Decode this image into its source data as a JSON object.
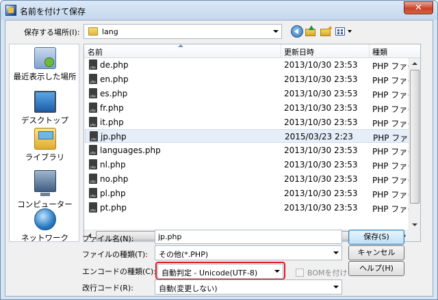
{
  "window": {
    "title": "名前を付けて保存",
    "close_label": "✕"
  },
  "save_location": {
    "label": "保存する場所(I):",
    "value": "lang"
  },
  "places": [
    {
      "label": "最近表示した場所"
    },
    {
      "label": "デスクトップ"
    },
    {
      "label": "ライブラリ"
    },
    {
      "label": "コンピューター"
    },
    {
      "label": "ネットワーク"
    }
  ],
  "columns": {
    "name": "名前",
    "date": "更新日時",
    "type": "種類"
  },
  "files": [
    {
      "name": "de.php",
      "date": "2013/10/30 23:53",
      "type": "PHP ファイ"
    },
    {
      "name": "en.php",
      "date": "2013/10/30 23:53",
      "type": "PHP ファイ"
    },
    {
      "name": "es.php",
      "date": "2013/10/30 23:53",
      "type": "PHP ファイ"
    },
    {
      "name": "fr.php",
      "date": "2013/10/30 23:53",
      "type": "PHP ファイ"
    },
    {
      "name": "it.php",
      "date": "2013/10/30 23:53",
      "type": "PHP ファイ"
    },
    {
      "name": "jp.php",
      "date": "2015/03/23 2:23",
      "type": "PHP ファイ"
    },
    {
      "name": "languages.php",
      "date": "2013/10/30 23:53",
      "type": "PHP ファイ"
    },
    {
      "name": "nl.php",
      "date": "2013/10/30 23:53",
      "type": "PHP ファイ"
    },
    {
      "name": "no.php",
      "date": "2013/10/30 23:53",
      "type": "PHP ファイ"
    },
    {
      "name": "pl.php",
      "date": "2013/10/30 23:53",
      "type": "PHP ファイ"
    },
    {
      "name": "pt.php",
      "date": "2013/10/30 23:53",
      "type": "PHP ファイ"
    }
  ],
  "form": {
    "filename_label": "ファイル名(N):",
    "filename_value": "jp.php",
    "filetype_label": "ファイルの種類(T):",
    "filetype_value": "その他(*.PHP)",
    "encoding_label": "エンコードの種類(C):",
    "encoding_value": "自動判定 - Unicode(UTF-8)",
    "bom_label": "BOMを付ける",
    "newline_label": "改行コード(R):",
    "newline_value": "自動(変更しない)"
  },
  "buttons": {
    "save": "保存(S)",
    "cancel": "キャンセル",
    "help": "ヘルプ(H)"
  },
  "colors": {
    "highlight": "#e2131b",
    "selected_row": "#e5eef9",
    "title_bg": "#c5d8ee"
  }
}
